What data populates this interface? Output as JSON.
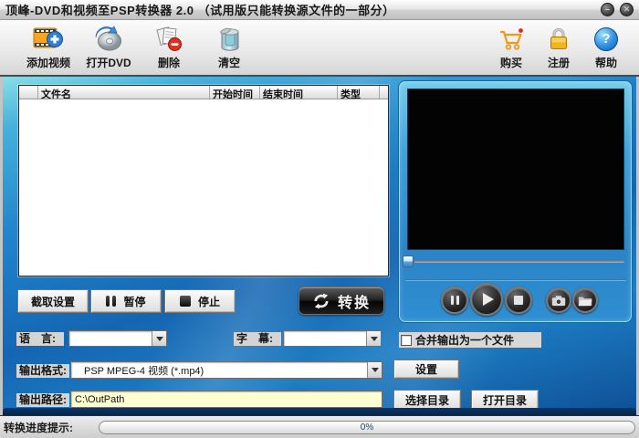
{
  "window": {
    "title": "顶峰-DVD和视频至PSP转换器 2.0 （试用版只能转换源文件的一部分）",
    "controls": {
      "minimize": "–",
      "close": "✕"
    }
  },
  "toolbar": {
    "items": [
      {
        "label": "添加视频",
        "icon": "add-video-icon"
      },
      {
        "label": "打开DVD",
        "icon": "open-dvd-icon"
      },
      {
        "label": "删除",
        "icon": "delete-icon"
      },
      {
        "label": "清空",
        "icon": "clear-icon"
      }
    ],
    "right_items": [
      {
        "label": "购买",
        "icon": "buy-cart-icon"
      },
      {
        "label": "注册",
        "icon": "register-lock-icon"
      },
      {
        "label": "帮助",
        "icon": "help-icon",
        "glyph": "?"
      }
    ]
  },
  "file_list": {
    "columns": [
      "",
      "文件名",
      "开始时间",
      "结束时间",
      "类型"
    ]
  },
  "actions": {
    "capture": "截取设置",
    "pause": "暂停",
    "stop": "停止",
    "convert": "转换"
  },
  "options": {
    "language_label": "语　言:",
    "language_value": "",
    "subtitle_label": "字　幕:",
    "subtitle_value": "",
    "merge_label": "合并输出为一个文件",
    "merge_checked": false,
    "format_label": "输出格式:",
    "format_value": "PSP MPEG-4 视频 (*.mp4)",
    "settings_button": "设置",
    "path_label": "输出路径:",
    "path_value": "C:\\OutPath",
    "choose_dir_button": "选择目录",
    "open_dir_button": "打开目录"
  },
  "status": {
    "label": "转换进度提示:",
    "progress_text": "0%",
    "progress_percent": 0
  },
  "colors": {
    "bg_top": "#8adee8",
    "bg_mid": "#1f7ec8",
    "bg_bottom": "#0e4f96",
    "panel_blue": "#2f8fd2",
    "path_field_bg": "#ffffd2",
    "convert_dark": "#1a1a1a"
  }
}
